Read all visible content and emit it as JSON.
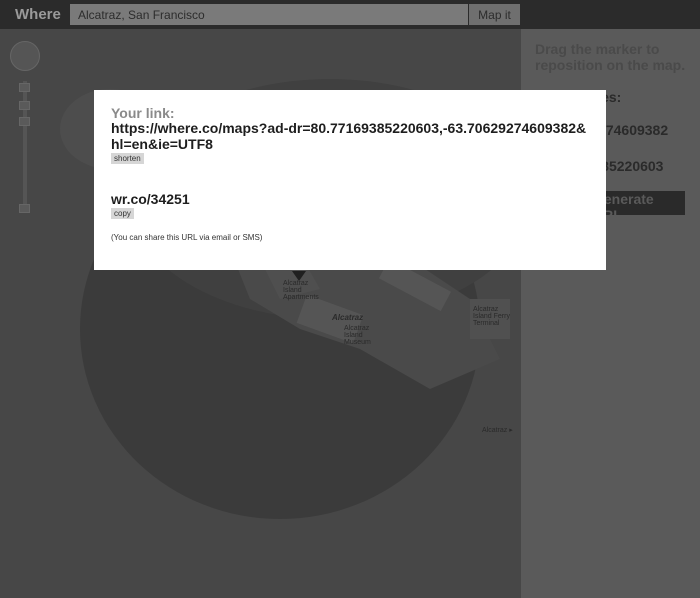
{
  "header": {
    "brand": "Where",
    "search_value": "Alcatraz, San Francisco",
    "map_button_label": "Map it"
  },
  "map": {
    "labels": {
      "island": "Alcatraz",
      "building": "Alcatraz Island Museum",
      "ferry": "Alcatraz Island Ferry Terminal",
      "left_building": "Alcatraz Island Apartments",
      "edge": "Alcatraz ▸"
    },
    "icons": [
      "navigation-control-icon",
      "zoom-in-icon",
      "zoom-out-icon",
      "marker-icon"
    ]
  },
  "sidebar": {
    "instructions": "Drag the marker to reposition on the map.",
    "coords_heading": "Coordinates:",
    "longitude": "-63.70629274609382",
    "latitude": "80.77169385220603",
    "generate_label": "Generate URL"
  },
  "modal": {
    "heading": "Your link:",
    "long_url": "https://where.co/maps?ad-dr=80.77169385220603,-63.70629274609382&hl=en&ie=UTF8",
    "shorten_label": "shorten",
    "short_url": "wr.co/34251",
    "copy_label": "copy",
    "share_note": "(You can share this URL via email or SMS)"
  },
  "colors": {
    "topbar": "#2b2b2b",
    "map": "#474747",
    "sidebar": "#5a5a5a",
    "modal": "#ffffff"
  }
}
